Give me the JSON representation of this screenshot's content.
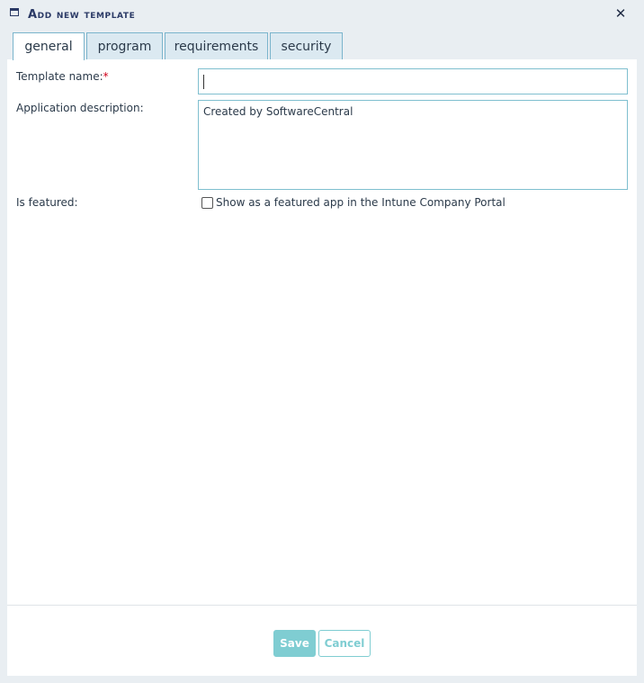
{
  "dialog": {
    "title": "Add new template",
    "icon": "window-icon",
    "close_glyph": "✕"
  },
  "tabs": [
    {
      "label": "general",
      "active": true
    },
    {
      "label": "program",
      "active": false
    },
    {
      "label": "requirements",
      "active": false
    },
    {
      "label": "security",
      "active": false
    }
  ],
  "form": {
    "template_name_label": "Template name:",
    "required_marker": "*",
    "template_name_value": "",
    "description_label": "Application description:",
    "description_value": "Created by SoftwareCentral",
    "featured_label": "Is featured:",
    "featured_checkbox_label": "Show as a featured app in the Intune Company Portal",
    "featured_checked": false
  },
  "footer": {
    "save_label": "Save",
    "cancel_label": "Cancel"
  },
  "colors": {
    "title": "#2b3a66",
    "tab_border": "#7ab4cc",
    "accent": "#7fcdd2",
    "required": "#d0021b"
  }
}
